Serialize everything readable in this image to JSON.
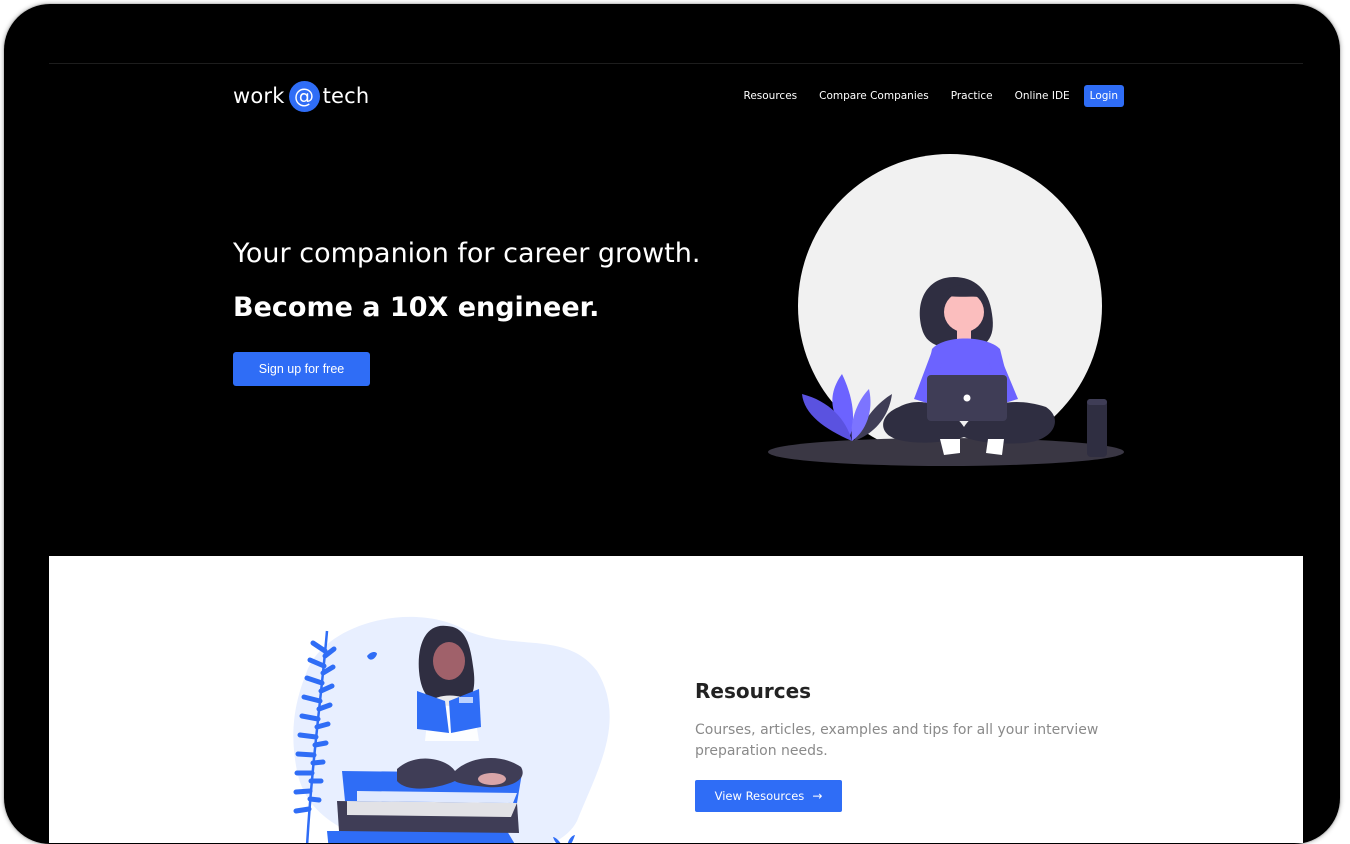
{
  "brand": {
    "left": "work",
    "at": "@",
    "right": "tech"
  },
  "nav": {
    "items": [
      "Resources",
      "Compare Companies",
      "Practice",
      "Online IDE"
    ],
    "login": "Login"
  },
  "hero": {
    "title": "Your companion for career growth.",
    "subtitle": "Become a 10X engineer.",
    "cta": "Sign up for free"
  },
  "resources": {
    "title": "Resources",
    "description": "Courses, articles, examples and tips for all your interview preparation needs.",
    "cta": "View Resources",
    "cta_icon": "→"
  },
  "colors": {
    "accent": "#2f6df6",
    "hero_bg": "#000000",
    "illustration_purple": "#6c63ff"
  }
}
